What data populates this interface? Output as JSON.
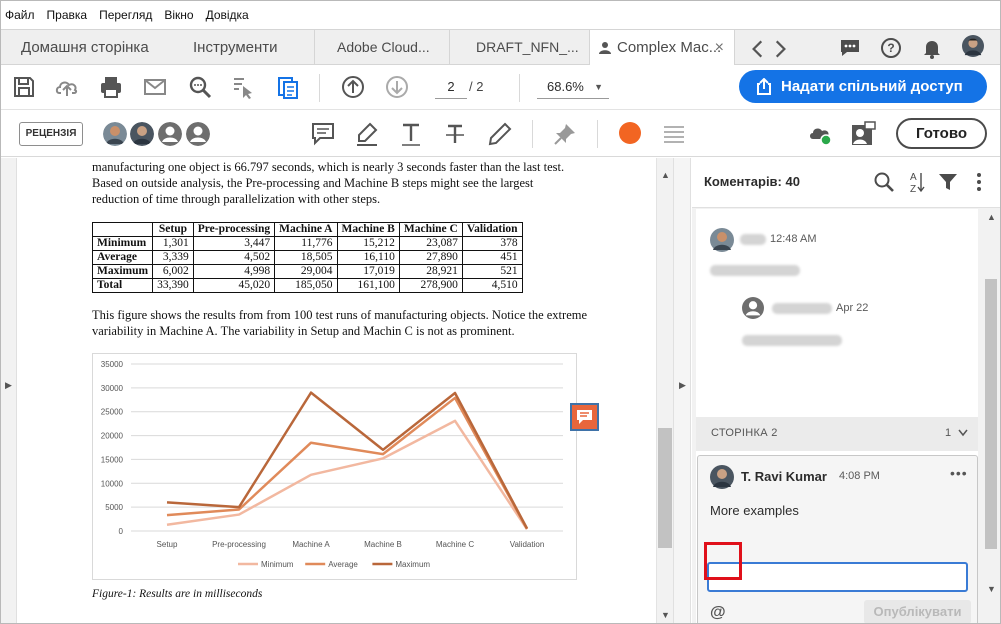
{
  "menu": [
    "Файл",
    "Правка",
    "Перегляд",
    "Вікно",
    "Довідка"
  ],
  "tabs": {
    "home": "Домашня сторінка",
    "tools": "Інструменти",
    "docs": [
      "Adobe Cloud...",
      "DRAFT_NFN_...",
      "Complex Mac..."
    ]
  },
  "toolbar": {
    "page_current": "2",
    "page_total": "/  2",
    "zoom": "68.6%",
    "share_label": "Надати спільний доступ",
    "review_label": "РЕЦЕНЗІЯ",
    "done_label": "Готово"
  },
  "document": {
    "para1": "manufacturing one object is 66.797 seconds, which is nearly 3 seconds faster than the last test. Based on outside analysis, the Pre-processing and Machine B steps might see the largest reduction of time through parallelization with other steps.",
    "para2": "This figure shows the results from from 100 test runs of manufacturing objects. Notice the extreme variability in Machine A. The variability in Setup and Machin C is not as prominent.",
    "table": {
      "headers": [
        "",
        "Setup",
        "Pre-processing",
        "Machine A",
        "Machine B",
        "Machine C",
        "Validation"
      ],
      "rows": [
        [
          "Minimum",
          "1,301",
          "3,447",
          "11,776",
          "15,212",
          "23,087",
          "378"
        ],
        [
          "Average",
          "3,339",
          "4,502",
          "18,505",
          "16,110",
          "27,890",
          "451"
        ],
        [
          "Maximum",
          "6,002",
          "4,998",
          "29,004",
          "17,019",
          "28,921",
          "521"
        ],
        [
          "Total",
          "33,390",
          "45,020",
          "185,050",
          "161,100",
          "278,900",
          "4,510"
        ]
      ]
    },
    "caption": "Figure-1: Results are in milliseconds"
  },
  "chart_data": {
    "type": "line",
    "categories": [
      "Setup",
      "Pre-processing",
      "Machine A",
      "Machine B",
      "Machine C",
      "Validation"
    ],
    "ylim": [
      0,
      35000
    ],
    "yticks": [
      "0",
      "5000",
      "10000",
      "15000",
      "20000",
      "25000",
      "30000",
      "35000"
    ],
    "grid": true,
    "legend": "bottom",
    "series": [
      {
        "name": "Minimum",
        "color": "#f2b8a0",
        "values": [
          1301,
          3447,
          11776,
          15212,
          23087,
          378
        ]
      },
      {
        "name": "Average",
        "color": "#e08a5a",
        "values": [
          3339,
          4502,
          18505,
          16110,
          27890,
          451
        ]
      },
      {
        "name": "Maximum",
        "color": "#b9673a",
        "values": [
          6002,
          4998,
          29004,
          17019,
          28921,
          521
        ]
      }
    ]
  },
  "comments": {
    "title": "Коментарів: 40",
    "first_time": "12:48 AM",
    "reply_date": "Apr 22",
    "page_section": "СТОРІНКА 2",
    "page_count": "1",
    "card": {
      "author": "T. Ravi Kumar",
      "time": "4:08 PM",
      "body": "More examples",
      "mention_symbol": "@",
      "publish_label": "Опублікувати"
    }
  },
  "colors": {
    "accent": "#1473e6",
    "highlight": "#e0101a",
    "record": "#f26522"
  }
}
